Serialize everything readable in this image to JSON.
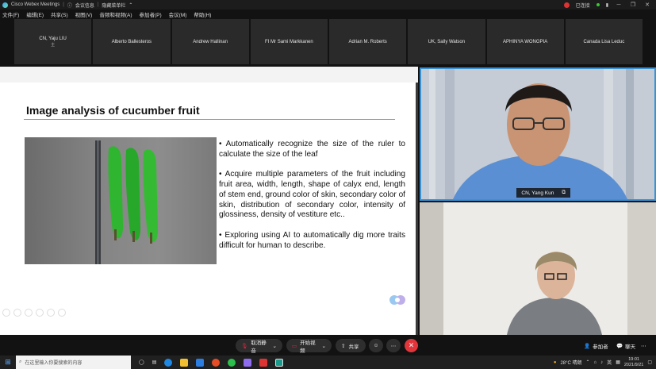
{
  "titlebar": {
    "app": "Cisco Webex Meetings",
    "info": "会议信息",
    "hide_menu": "隐藏菜单栏",
    "connected": "已连接",
    "colors": {
      "rec": "#d33333",
      "status": "#33cc33"
    }
  },
  "menubar": {
    "items": [
      "文件(F)",
      "编辑(E)",
      "共享(S)",
      "视图(V)",
      "音频和视频(A)",
      "参加者(P)",
      "会议(M)",
      "帮助(H)"
    ]
  },
  "participants": [
    {
      "name": "CN, Yaju LIU",
      "sub": "主"
    },
    {
      "name": "Alberto Ballesteros",
      "sub": ""
    },
    {
      "name": "Andrew Hallinan",
      "sub": ""
    },
    {
      "name": "FI Mr Sami Markkanen",
      "sub": ""
    },
    {
      "name": "Adrian M. Roberts",
      "sub": ""
    },
    {
      "name": "UK, Sally Watson",
      "sub": ""
    },
    {
      "name": "APHINYA WONGPIA",
      "sub": ""
    },
    {
      "name": "Canada Lisa Leduc",
      "sub": ""
    }
  ],
  "slide": {
    "title": "Image analysis of cucumber fruit",
    "bullets": [
      "•  Automatically recognize the size of the ruler to calculate the size of the leaf",
      "•  Acquire multiple parameters of the fruit including fruit area, width, length, shape of calyx end, length of stem end, ground color of skin, secondary color of skin, distribution of secondary color, intensity of glossiness, density of vestiture etc..",
      "•  Exploring using AI to automatically dig more traits difficult for human to describe."
    ]
  },
  "videos": {
    "active_speaker": "CN, Yang Kun",
    "accent": "#3a92d6"
  },
  "controls": {
    "mute": "取消静音",
    "start_video": "开始视频",
    "share": "共享",
    "participants": "参加者",
    "chat": "聊天",
    "end_color": "#e0353b"
  },
  "taskbar": {
    "search_placeholder": "在这里输入你要搜索的内容",
    "weather": "28°C 晴朗",
    "lang": "英",
    "time": "19:01",
    "date": "2021/9/21"
  }
}
